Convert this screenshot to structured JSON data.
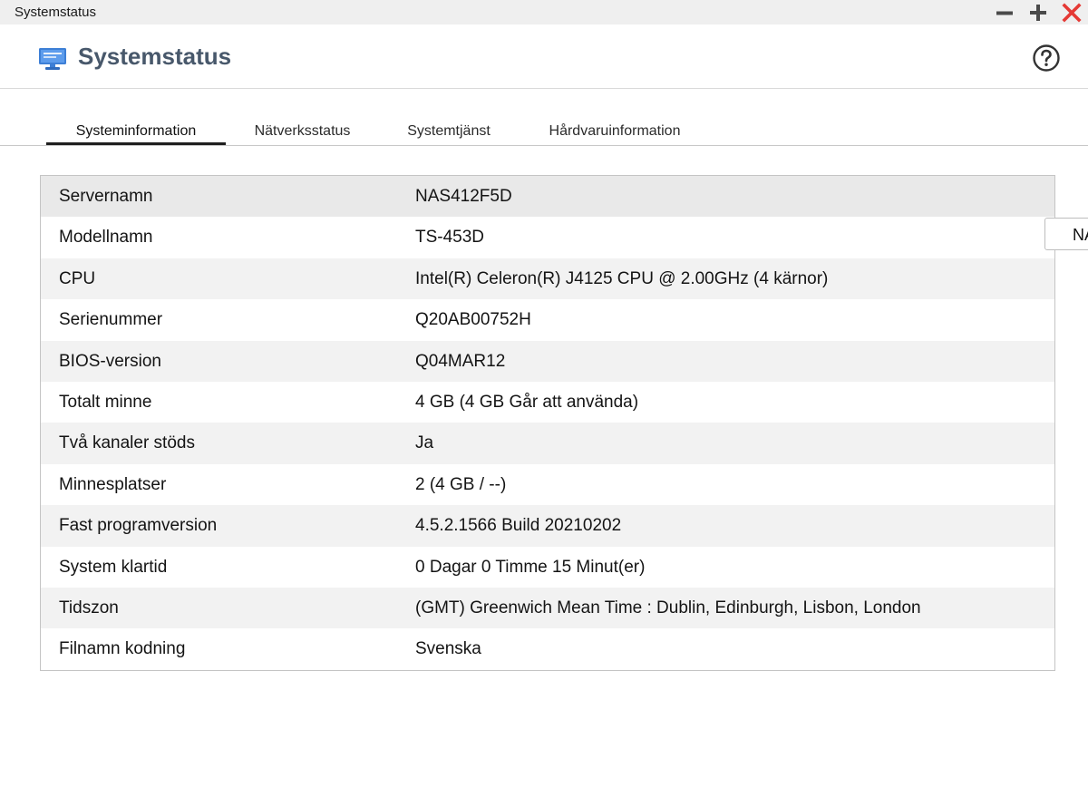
{
  "window": {
    "title": "Systemstatus"
  },
  "header": {
    "title": "Systemstatus",
    "help_icon": "help-circle-icon",
    "app_icon": "monitor-icon"
  },
  "tabs": [
    {
      "label": "Systeminformation",
      "active": true
    },
    {
      "label": "Nätverksstatus",
      "active": false
    },
    {
      "label": "Systemtjänst",
      "active": false
    },
    {
      "label": "Hårdvaruinformation",
      "active": false
    }
  ],
  "system_info": [
    {
      "label": "Servernamn",
      "value": "NAS412F5D"
    },
    {
      "label": "Modellnamn",
      "value": "TS-453D"
    },
    {
      "label": "CPU",
      "value": "Intel(R) Celeron(R) J4125 CPU @ 2.00GHz (4 kärnor)"
    },
    {
      "label": "Serienummer",
      "value": "Q20AB00752H"
    },
    {
      "label": "BIOS-version",
      "value": "Q04MAR12"
    },
    {
      "label": "Totalt minne",
      "value": "4 GB (4 GB Går att använda)"
    },
    {
      "label": "Två kanaler stöds",
      "value": "Ja"
    },
    {
      "label": "Minnesplatser",
      "value": "2 (4 GB / --)"
    },
    {
      "label": "Fast programversion",
      "value": "4.5.2.1566 Build 20210202"
    },
    {
      "label": "System klartid",
      "value": "0 Dagar 0 Timme 15 Minut(er)"
    },
    {
      "label": "Tidszon",
      "value": "(GMT) Greenwich Mean Time : Dublin, Edinburgh, Lisbon, London"
    },
    {
      "label": "Filnamn kodning",
      "value": "Svenska"
    }
  ],
  "side_button": {
    "label": "NA"
  },
  "colors": {
    "accent_close": "#e53935",
    "title_text": "#48586b",
    "window_control": "#4a4a4a"
  }
}
